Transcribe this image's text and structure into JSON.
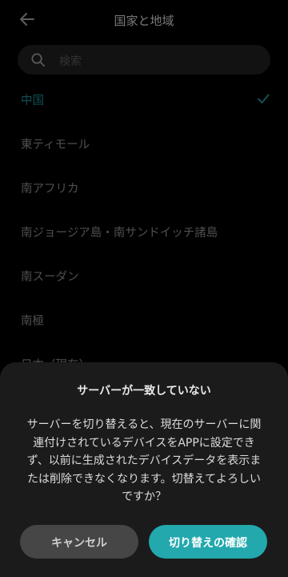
{
  "header": {
    "title": "国家と地域"
  },
  "search": {
    "placeholder": "検索"
  },
  "list": {
    "items": [
      {
        "label": "中国",
        "selected": true
      },
      {
        "label": "東ティモール",
        "selected": false
      },
      {
        "label": "南アフリカ",
        "selected": false
      },
      {
        "label": "南ジョージア島・南サンドイッチ諸島",
        "selected": false
      },
      {
        "label": "南スーダン",
        "selected": false
      },
      {
        "label": "南極",
        "selected": false
      },
      {
        "label": "日本（現在）",
        "selected": false
      }
    ]
  },
  "dialog": {
    "title": "サーバーが一致していない",
    "message": "サーバーを切り替えると、現在のサーバーに関連付けされているデバイスをAPPに設定できず、以前に生成されたデバイスデータを表示または削除できなくなります。切替えてよろしいですか？",
    "cancel_label": "キャンセル",
    "confirm_label": "切り替えの確認"
  },
  "colors": {
    "background": "#000000",
    "accent": "#22a8ad",
    "selected_text": "#1d7c80",
    "sheet": "#1b1b1b"
  },
  "icons": {
    "back": "arrow-left-icon",
    "search": "search-icon",
    "check": "checkmark-icon"
  }
}
